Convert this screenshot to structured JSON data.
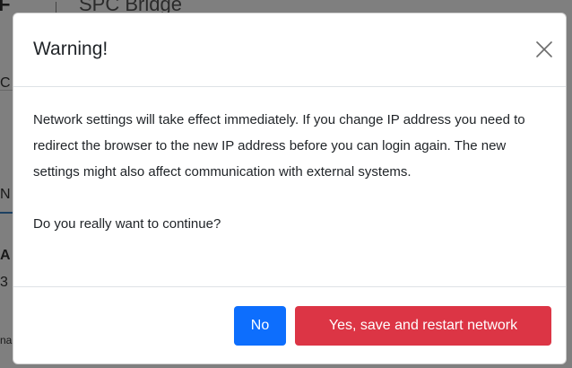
{
  "background": {
    "logo": "IF",
    "product": "SPC Bridge",
    "fragments": [
      "C",
      "N",
      "A",
      "3",
      "na"
    ]
  },
  "modal": {
    "title": "Warning!",
    "close_icon": "close-icon",
    "paragraph": "Network settings will take effect immediately. If you change IP address you need to redirect the browser to the new IP address before you can login again. The new settings might also affect communication with external systems.",
    "question": "Do you really want to continue?",
    "buttons": {
      "no": "No",
      "yes": "Yes, save and restart network"
    }
  },
  "colors": {
    "primary": "#0d6efd",
    "danger": "#dc3545"
  }
}
